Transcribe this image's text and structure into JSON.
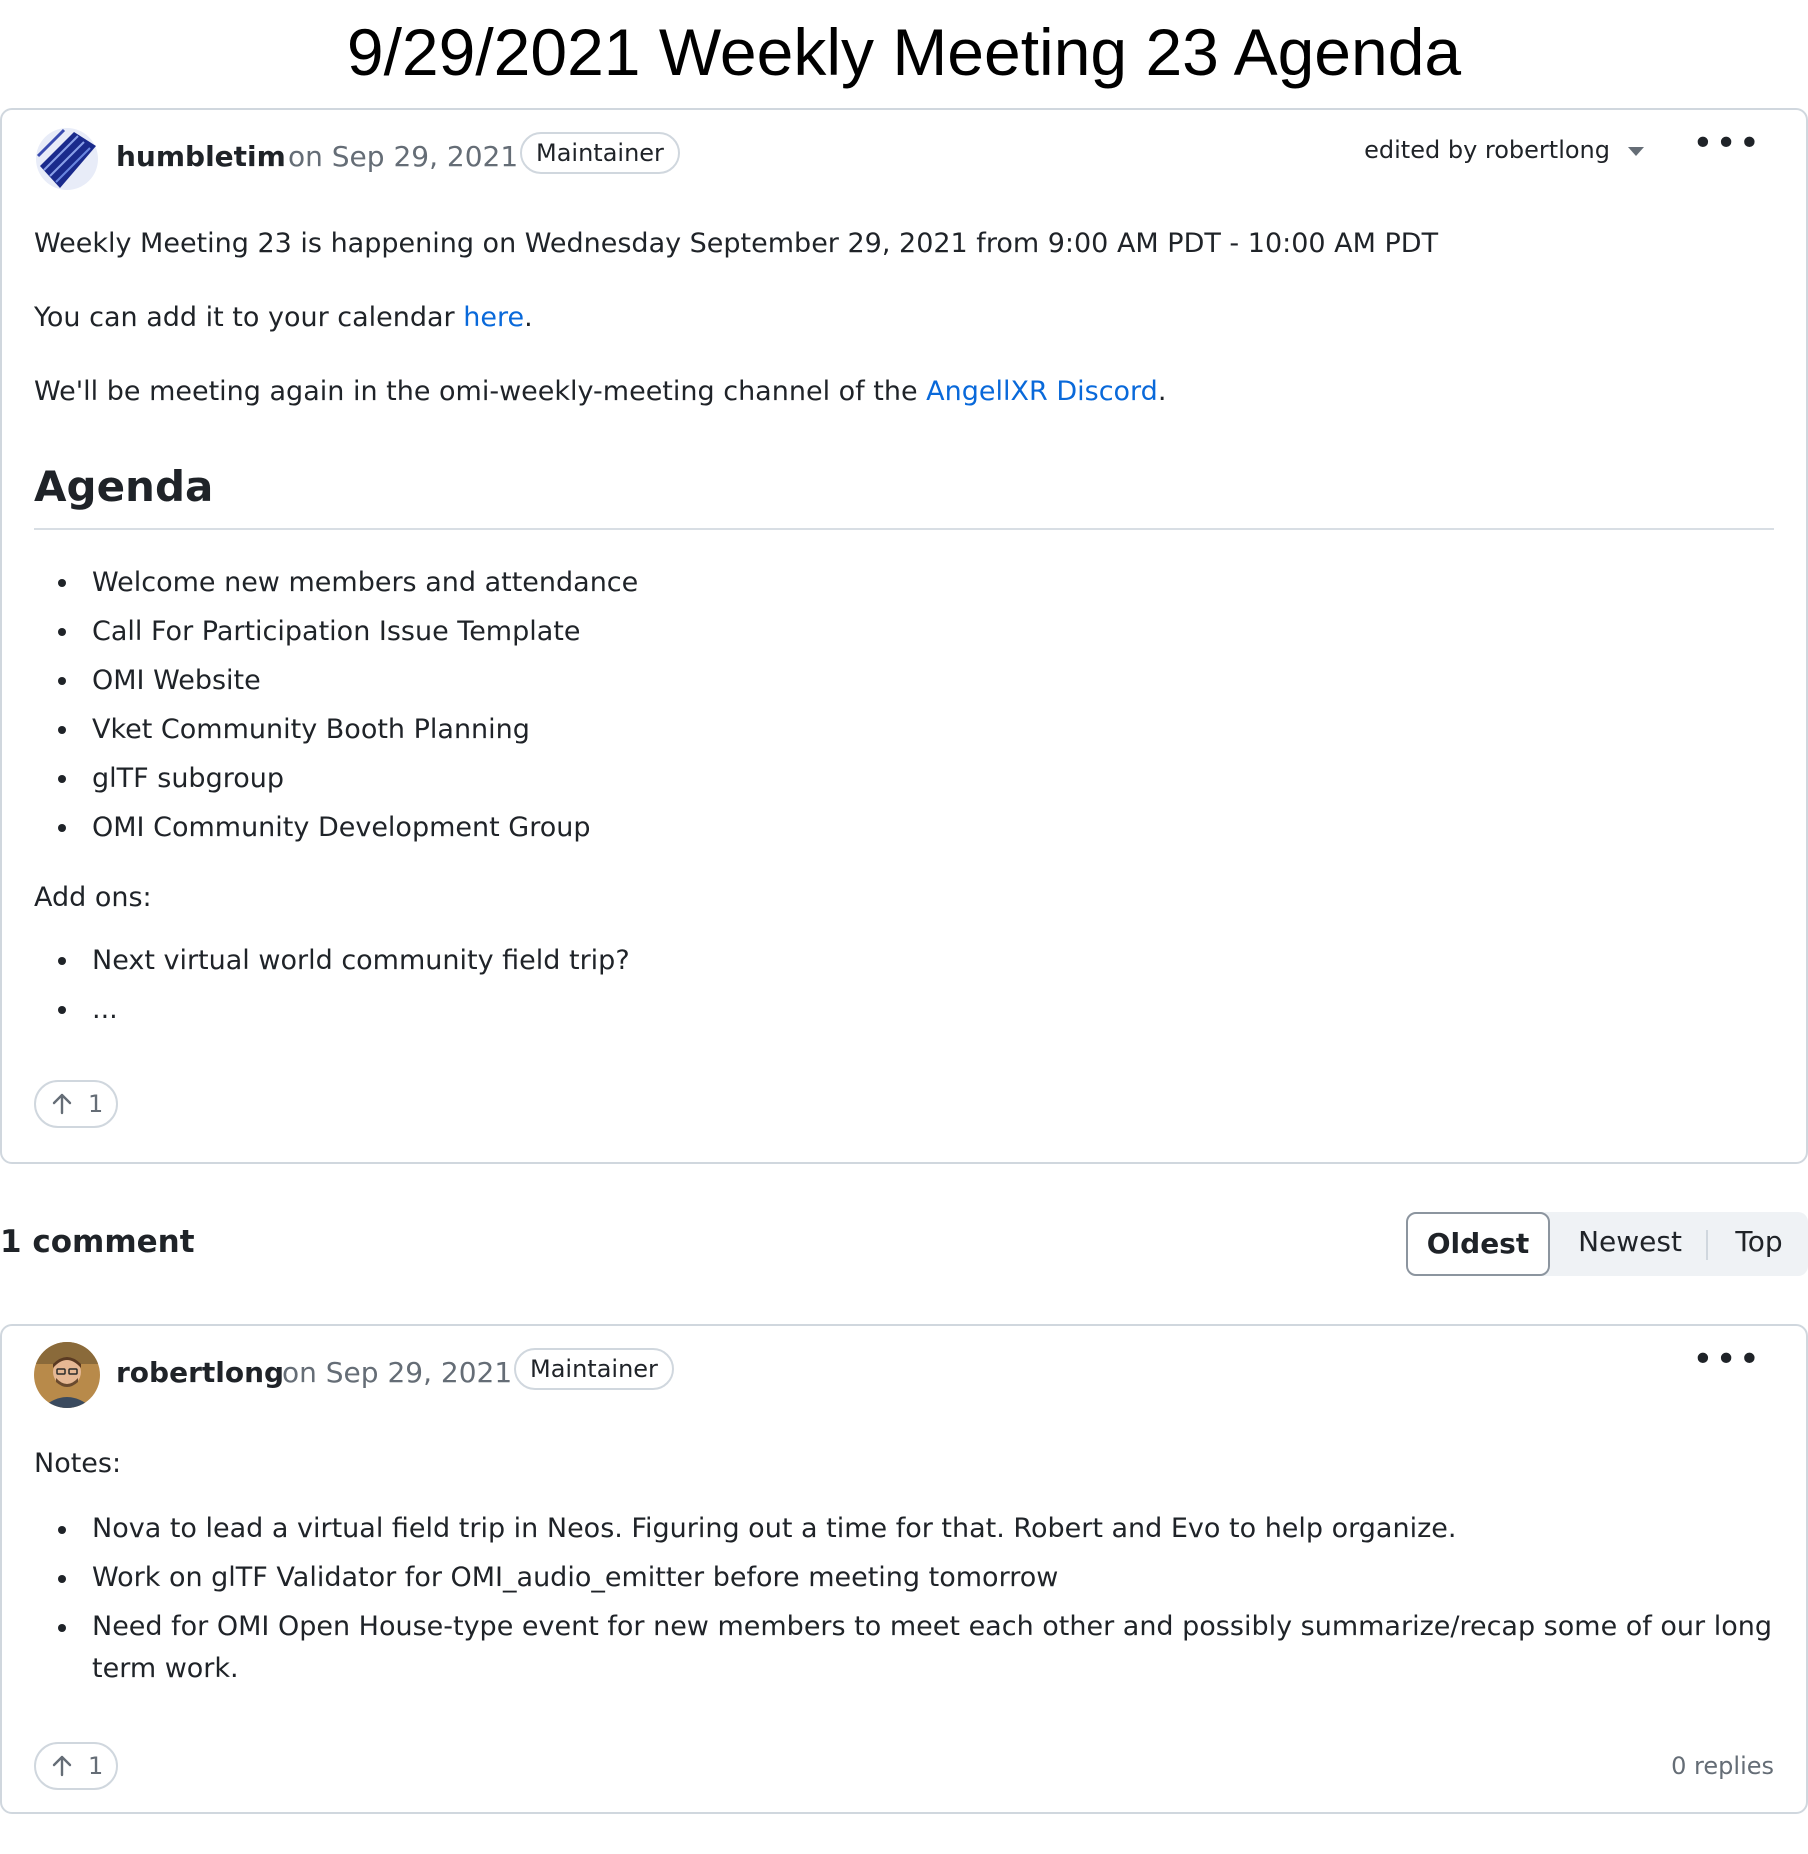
{
  "page": {
    "title": "9/29/2021 Weekly Meeting 23 Agenda"
  },
  "post": {
    "author": "humbletim",
    "date": "on Sep 29, 2021",
    "badge": "Maintainer",
    "edited_by": "edited by robertlong",
    "menu_icon": "kebab-menu-icon",
    "paragraph1": "Weekly Meeting 23 is happening on Wednesday September 29, 2021 from 9:00 AM PDT - 10:00 AM PDT",
    "paragraph2_prefix": "You can add it to your calendar ",
    "paragraph2_link": "here",
    "paragraph2_suffix": ".",
    "paragraph3_prefix": "We'll be meeting again in the omi-weekly-meeting channel of the ",
    "paragraph3_link": "AngellXR Discord",
    "paragraph3_suffix": ".",
    "agenda_heading": "Agenda",
    "agenda_items": [
      "Welcome new members and attendance",
      "Call For Participation Issue Template",
      "OMI Website",
      "Vket Community Booth Planning",
      "glTF subgroup",
      "OMI Community Development Group"
    ],
    "addons_label": "Add ons:",
    "addon_items": [
      "Next virtual world community field trip?",
      "..."
    ],
    "upvotes": "1"
  },
  "comments_section": {
    "heading": "1 comment",
    "sort": {
      "oldest": "Oldest",
      "newest": "Newest",
      "top": "Top",
      "selected": "Oldest"
    }
  },
  "comment": {
    "author": "robertlong",
    "date": "on Sep 29, 2021",
    "badge": "Maintainer",
    "notes_label": "Notes:",
    "notes": [
      "Nova to lead a virtual field trip in Neos. Figuring out a time for that. Robert and Evo to help organize.",
      "Work on glTF Validator for OMI_audio_emitter before meeting tomorrow",
      "Need for OMI Open House-type event for new members to meet each other and possibly summarize/recap some of our long term work."
    ],
    "upvotes": "1",
    "replies": "0 replies"
  },
  "colors": {
    "link": "#0969da",
    "border": "#d0d7de",
    "muted": "#656d76"
  }
}
